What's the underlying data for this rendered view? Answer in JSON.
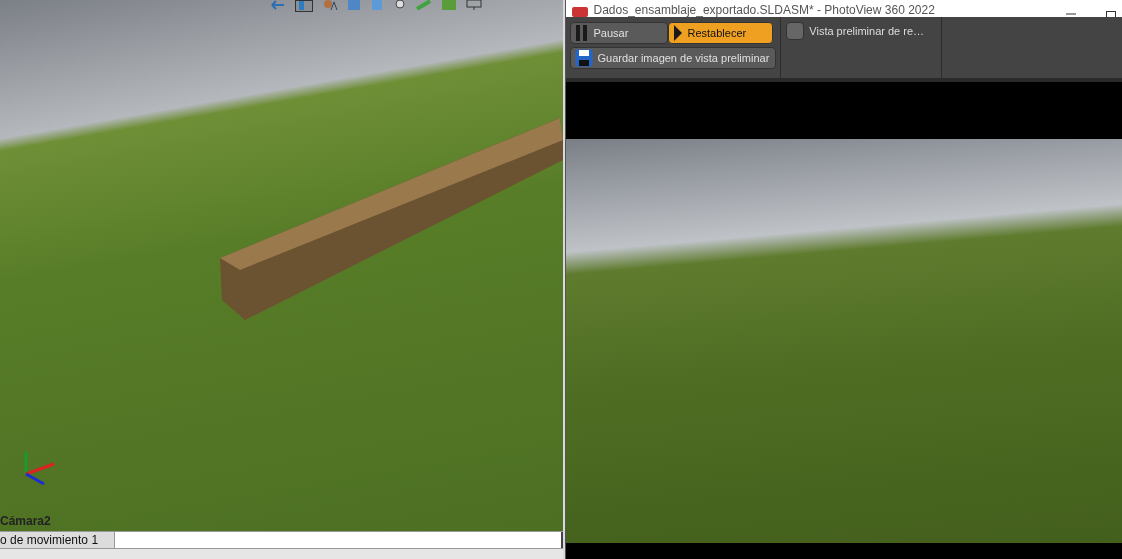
{
  "cad_window": {
    "viewport_label": "Cámara2",
    "motion_tab": "o de movimiento 1"
  },
  "render_window": {
    "title": "Dados_ensamblaje_exportado.SLDASM* - PhotoView 360 2022",
    "buttons": [
      {
        "label": "Pausar",
        "kind": "pause",
        "highlighted": false
      },
      {
        "label": "Restablecer",
        "kind": "play",
        "highlighted": true
      },
      {
        "label": "Guardar imagen de vista preliminar",
        "kind": "save",
        "highlighted": false
      }
    ],
    "option": {
      "label": "Vista preliminar de re…",
      "checked": false
    }
  }
}
